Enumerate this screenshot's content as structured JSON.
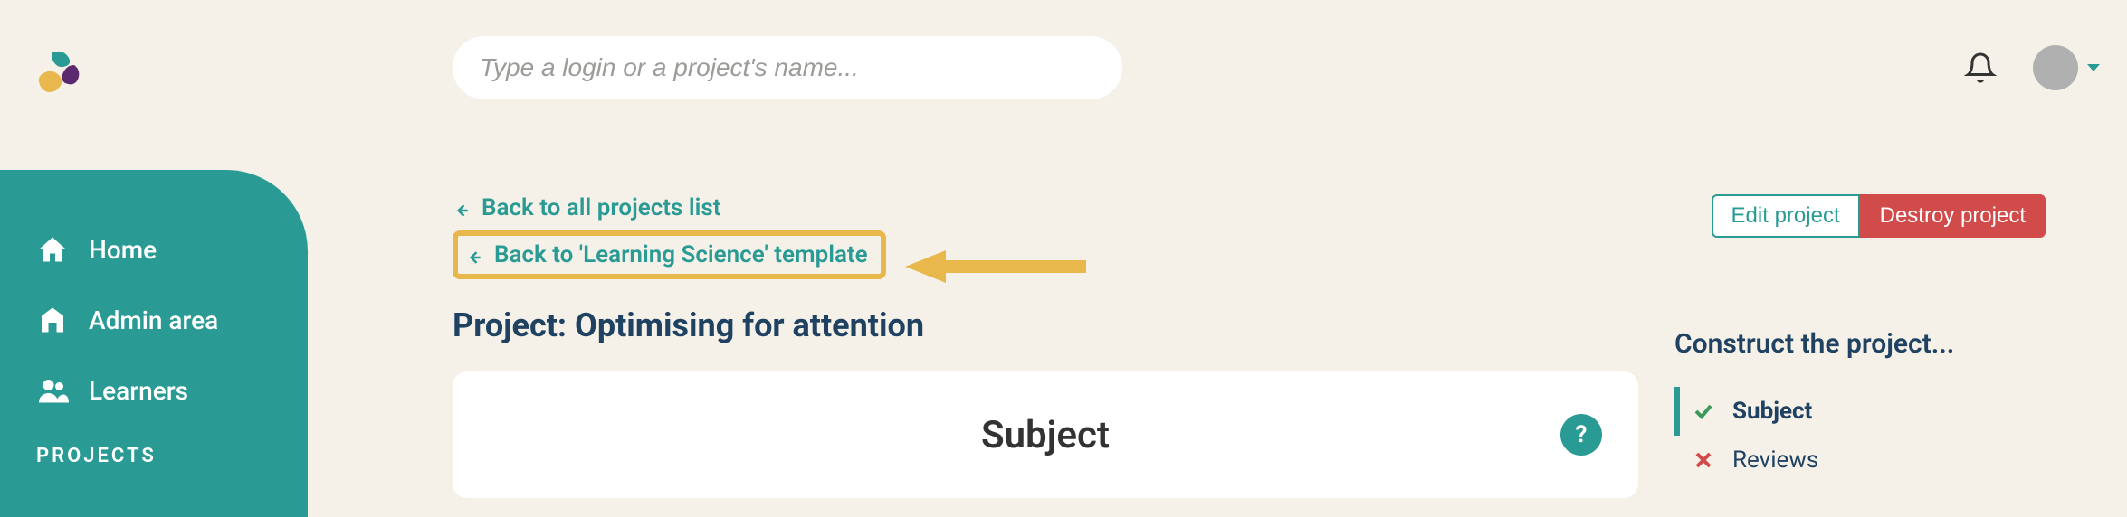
{
  "search": {
    "placeholder": "Type a login or a project's name..."
  },
  "sidebar": {
    "items": [
      {
        "label": "Home"
      },
      {
        "label": "Admin area"
      },
      {
        "label": "Learners"
      }
    ],
    "section": "PROJECTS"
  },
  "nav": {
    "back_all": "Back to all projects list",
    "back_template": "Back to 'Learning Science' template"
  },
  "page": {
    "title": "Project: Optimising for attention",
    "card_heading": "Subject",
    "help": "?"
  },
  "actions": {
    "edit": "Edit project",
    "destroy": "Destroy project"
  },
  "construct": {
    "title": "Construct the project...",
    "steps": [
      {
        "label": "Subject",
        "status": "done",
        "active": true
      },
      {
        "label": "Reviews",
        "status": "pending",
        "active": false
      }
    ]
  }
}
